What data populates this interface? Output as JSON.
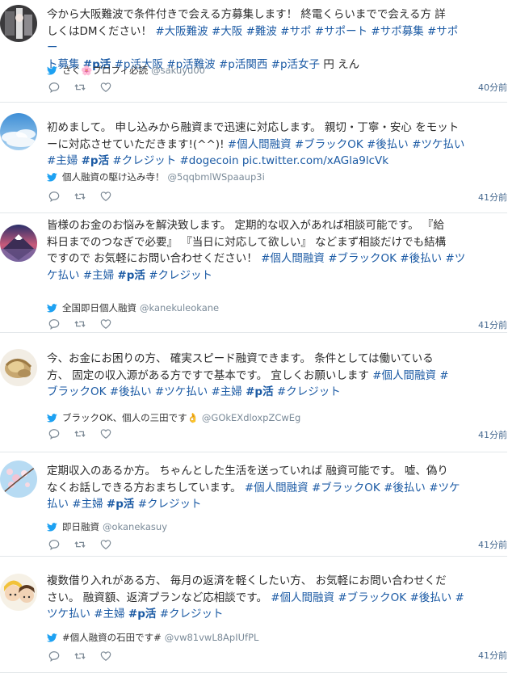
{
  "tweets": [
    {
      "text_lines": [
        [
          {
            "t": "今から大阪難波で条件付きで会える方募集します！ 終電くらいまでで会える方 詳"
          }
        ],
        [
          {
            "t": "しくはDMください！ "
          },
          {
            "tag": "#大阪難波"
          },
          {
            "t": " "
          },
          {
            "tag": "#大阪"
          },
          {
            "t": " "
          },
          {
            "tag": "#難波"
          },
          {
            "t": " "
          },
          {
            "tag": "#サポ"
          },
          {
            "t": " "
          },
          {
            "tag": "#サポート"
          },
          {
            "t": " "
          },
          {
            "tag": "#サポ募集"
          },
          {
            "t": " "
          },
          {
            "tag": "#サポー"
          }
        ],
        [
          {
            "tag": "ト募集"
          },
          {
            "t": " "
          },
          {
            "tag": "#p活",
            "bold": true
          },
          {
            "t": " "
          },
          {
            "tag": "#p活大阪"
          },
          {
            "t": " "
          },
          {
            "tag": "#p活難波"
          },
          {
            "t": " "
          },
          {
            "tag": "#p活関西"
          },
          {
            "t": " "
          },
          {
            "tag": "#p活女子"
          },
          {
            "t": " 円 えん"
          }
        ]
      ],
      "name": "さく🌸プロフィ必読",
      "handle": "@sakuyu00",
      "time": "40分前",
      "avatar": "dark-photo"
    },
    {
      "text_lines": [
        [
          {
            "t": "初めまして。 申し込みから融資まで迅速に対応します。 親切・丁寧・安心 をモット"
          }
        ],
        [
          {
            "t": "ーに対応させていただきます!(^^)! "
          },
          {
            "tag": "#個人間融資"
          },
          {
            "t": " "
          },
          {
            "tag": "#ブラックOK"
          },
          {
            "t": " "
          },
          {
            "tag": "#後払い"
          },
          {
            "t": " "
          },
          {
            "tag": "#ツケ払い"
          }
        ],
        [
          {
            "tag": "#主婦"
          },
          {
            "t": " "
          },
          {
            "tag": "#p活",
            "bold": true
          },
          {
            "t": " "
          },
          {
            "tag": "#クレジット"
          },
          {
            "t": " "
          },
          {
            "tag": "#dogecoin"
          },
          {
            "t": " "
          },
          {
            "tag": "pic.twitter.com/xAGla9lcVk"
          }
        ]
      ],
      "name": "個人融資の駆け込み寺！",
      "handle": "@5qqbmlWSpaaup3i",
      "time": "41分前",
      "avatar": "sky"
    },
    {
      "text_lines": [
        [
          {
            "t": "皆様のお金のお悩みを解決致します。 定期的な収入があれば相談可能です。 『給"
          }
        ],
        [
          {
            "t": "料日までのつなぎで必要』 『当日に対応して欲しい』 などまず相談だけでも結構"
          }
        ],
        [
          {
            "t": "ですので お気軽にお問い合わせください！ "
          },
          {
            "tag": "#個人間融資"
          },
          {
            "t": " "
          },
          {
            "tag": "#ブラックOK"
          },
          {
            "t": " "
          },
          {
            "tag": "#後払い"
          },
          {
            "t": " "
          },
          {
            "tag": "#ツ"
          }
        ],
        [
          {
            "tag": "ケ払い"
          },
          {
            "t": " "
          },
          {
            "tag": "#主婦"
          },
          {
            "t": " "
          },
          {
            "tag": "#p活",
            "bold": true
          },
          {
            "t": " "
          },
          {
            "tag": "#クレジット"
          }
        ]
      ],
      "name": "全国即日個人融資",
      "handle": "@kanekuleokane",
      "time": "41分前",
      "avatar": "fuji"
    },
    {
      "text_lines": [
        [
          {
            "t": "今、お金にお困りの方、 確実スピード融資できます。 条件としては働いている"
          }
        ],
        [
          {
            "t": "方、 固定の収入源がある方ですで基本です。 宜しくお願いします "
          },
          {
            "tag": "#個人間融資"
          },
          {
            "t": " "
          },
          {
            "tag": "#"
          }
        ],
        [
          {
            "tag": "ブラックOK"
          },
          {
            "t": " "
          },
          {
            "tag": "#後払い"
          },
          {
            "t": " "
          },
          {
            "tag": "#ツケ払い"
          },
          {
            "t": " "
          },
          {
            "tag": "#主婦"
          },
          {
            "t": " "
          },
          {
            "tag": "#p活",
            "bold": true
          },
          {
            "t": " "
          },
          {
            "tag": "#クレジット"
          }
        ]
      ],
      "name": "ブラックOK、個人の三田です👌",
      "handle": "@GOkEXdloxpZCwEg",
      "time": "41分前",
      "avatar": "gold"
    },
    {
      "text_lines": [
        [
          {
            "t": "定期収入のあるか方。 ちゃんとした生活を送っていれば 融資可能です。 嘘、偽り"
          }
        ],
        [
          {
            "t": "なくお話しできる方おまちしています。 "
          },
          {
            "tag": "#個人間融資"
          },
          {
            "t": " "
          },
          {
            "tag": "#ブラックOK"
          },
          {
            "t": " "
          },
          {
            "tag": "#後払い"
          },
          {
            "t": " "
          },
          {
            "tag": "#ツケ"
          }
        ],
        [
          {
            "tag": "払い"
          },
          {
            "t": " "
          },
          {
            "tag": "#主婦"
          },
          {
            "t": " "
          },
          {
            "tag": "#p活",
            "bold": true
          },
          {
            "t": " "
          },
          {
            "tag": "#クレジット"
          }
        ]
      ],
      "name": "即日融資",
      "handle": "@okanekasuy",
      "time": "41分前",
      "avatar": "blossom"
    },
    {
      "text_lines": [
        [
          {
            "t": "複数借り入れがある方、 毎月の返済を軽くしたい方、 お気軽にお問い合わせくだ"
          }
        ],
        [
          {
            "t": "さい。 融資額、返済プランなど応相談です。 "
          },
          {
            "tag": "#個人間融資"
          },
          {
            "t": " "
          },
          {
            "tag": "#ブラックOK"
          },
          {
            "t": " "
          },
          {
            "tag": "#後払い"
          },
          {
            "t": " "
          },
          {
            "tag": "#"
          }
        ],
        [
          {
            "tag": "ツケ払い"
          },
          {
            "t": " "
          },
          {
            "tag": "#主婦"
          },
          {
            "t": " "
          },
          {
            "tag": "#p活",
            "bold": true
          },
          {
            "t": " "
          },
          {
            "tag": "#クレジット"
          }
        ]
      ],
      "name": "#個人融資の石田です#",
      "handle": "@vw81vwL8ApIUfPL",
      "time": "41分前",
      "avatar": "anime"
    }
  ],
  "icons": {
    "source": "twitter-bird-icon",
    "reply": "reply-icon",
    "retweet": "retweet-icon",
    "like": "heart-icon"
  },
  "colors": {
    "hashtag": "#1b5aa4",
    "bird": "#1da1f2",
    "time": "#46698f",
    "handle": "#7a8a98"
  }
}
